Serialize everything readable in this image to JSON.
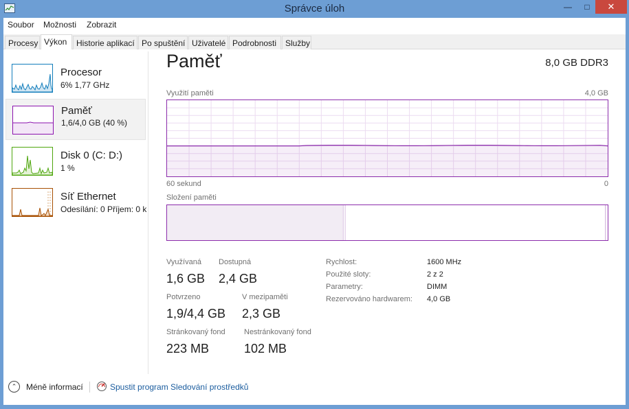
{
  "window": {
    "title": "Správce úloh",
    "icons": {
      "app": "task-manager-icon",
      "minimize": "minimize-icon",
      "maximize": "maximize-icon",
      "close": "close-icon"
    }
  },
  "menu": {
    "items": [
      {
        "label": "Soubor"
      },
      {
        "label": "Možnosti"
      },
      {
        "label": "Zobrazit"
      }
    ]
  },
  "tabs": [
    {
      "label": "Procesy",
      "active": false
    },
    {
      "label": "Výkon",
      "active": true
    },
    {
      "label": "Historie aplikací",
      "active": false
    },
    {
      "label": "Po spuštění",
      "active": false
    },
    {
      "label": "Uživatelé",
      "active": false
    },
    {
      "label": "Podrobnosti",
      "active": false
    },
    {
      "label": "Služby",
      "active": false
    }
  ],
  "sidebar": {
    "items": [
      {
        "name": "Procesor",
        "sub": "6% 1,77 GHz",
        "color": "#117dbb",
        "selected": false
      },
      {
        "name": "Paměť",
        "sub": "1,6/4,0 GB (40 %)",
        "color": "#8b12ae",
        "selected": true
      },
      {
        "name": "Disk 0 (C: D:)",
        "sub": "1 %",
        "color": "#4da60c",
        "selected": false
      },
      {
        "name": "Síť Ethernet",
        "sub": "Odesílání: 0 Příjem: 0 kb",
        "color": "#a74f01",
        "selected": false
      }
    ]
  },
  "main": {
    "title": "Paměť",
    "spec": "8,0 GB DDR3",
    "usage_label": "Využití paměti",
    "usage_max": "4,0 GB",
    "time_left": "60 sekund",
    "time_right": "0",
    "usage_fraction": 0.4,
    "composition_label": "Složení paměti",
    "composition": {
      "in_use_fraction": 0.4,
      "modified_fraction": 0.005,
      "standby_fraction": 0.59
    },
    "accent_color": "#8b2bab"
  },
  "stats": {
    "in_use_label": "Využívaná",
    "in_use": "1,6 GB",
    "available_label": "Dostupná",
    "available": "2,4 GB",
    "committed_label": "Potvrzeno",
    "committed": "1,9/4,4 GB",
    "cached_label": "V mezipaměti",
    "cached": "2,3 GB",
    "paged_label": "Stránkovaný fond",
    "paged": "223 MB",
    "nonpaged_label": "Nestránkovaný fond",
    "nonpaged": "102 MB"
  },
  "details": [
    {
      "key": "Rychlost:",
      "value": "1600 MHz"
    },
    {
      "key": "Použité sloty:",
      "value": "2 z 2"
    },
    {
      "key": "Parametry:",
      "value": "DIMM"
    },
    {
      "key": "Rezervováno hardwarem:",
      "value": "4,0 GB"
    }
  ],
  "footer": {
    "fewer_details": "Méně informací",
    "open_monitor": "Spustit program Sledování prostředků",
    "icons": {
      "fewer": "chevron-up-icon",
      "monitor": "resource-monitor-icon"
    }
  }
}
